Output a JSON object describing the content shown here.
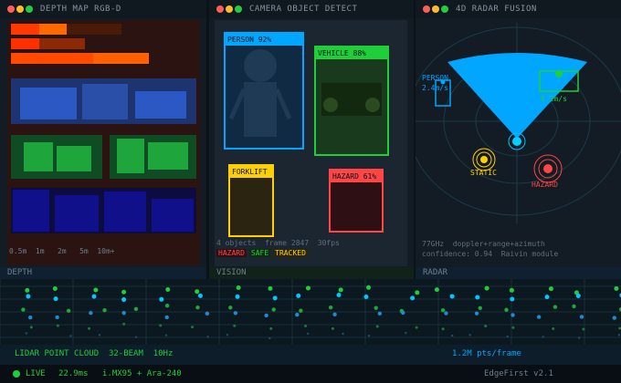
{
  "panels": {
    "depth": {
      "title": "DEPTH MAP  RGB-D",
      "footer": "DEPTH",
      "scale": "0.5m  1m   2m   5m  10m+"
    },
    "vision": {
      "title": "CAMERA  OBJECT DETECT",
      "footer": "VISION",
      "boxes": {
        "person": "PERSON  92%",
        "vehicle": "VEHICLE  88%",
        "forklift": "FORKLIFT",
        "hazard": "HAZARD  61%"
      },
      "stats": "4 objects  frame 2847  30fps",
      "legend": {
        "hazard": "HAZARD",
        "safe": "SAFE",
        "tracked": "TRACKED"
      }
    },
    "radar": {
      "title": "4D RADAR FUSION",
      "footer": "RADAR",
      "targets": {
        "person": "PERSON",
        "person_val": "2.4m/s",
        "vehicle_val": "8.2m/s",
        "static": "STATIC",
        "hazard": "HAZARD"
      },
      "info1": "77GHz  doppler+range+azimuth",
      "info2": "confidence: 0.94  Raivin module"
    }
  },
  "lidar": {
    "title": "LIDAR POINT CLOUD  32-BEAM  10Hz",
    "rate": "1.2M pts/frame"
  },
  "status": {
    "live": "LIVE",
    "latency": "22.9ms",
    "hw": "i.MX95 + Ara-240",
    "brand": "EdgeFirst v2.1"
  },
  "colors": {
    "accent": "#00a6ff",
    "green": "#1fcf3a",
    "orange": "#ff5a00",
    "red": "#ff4545",
    "yellow": "#ffd000"
  }
}
